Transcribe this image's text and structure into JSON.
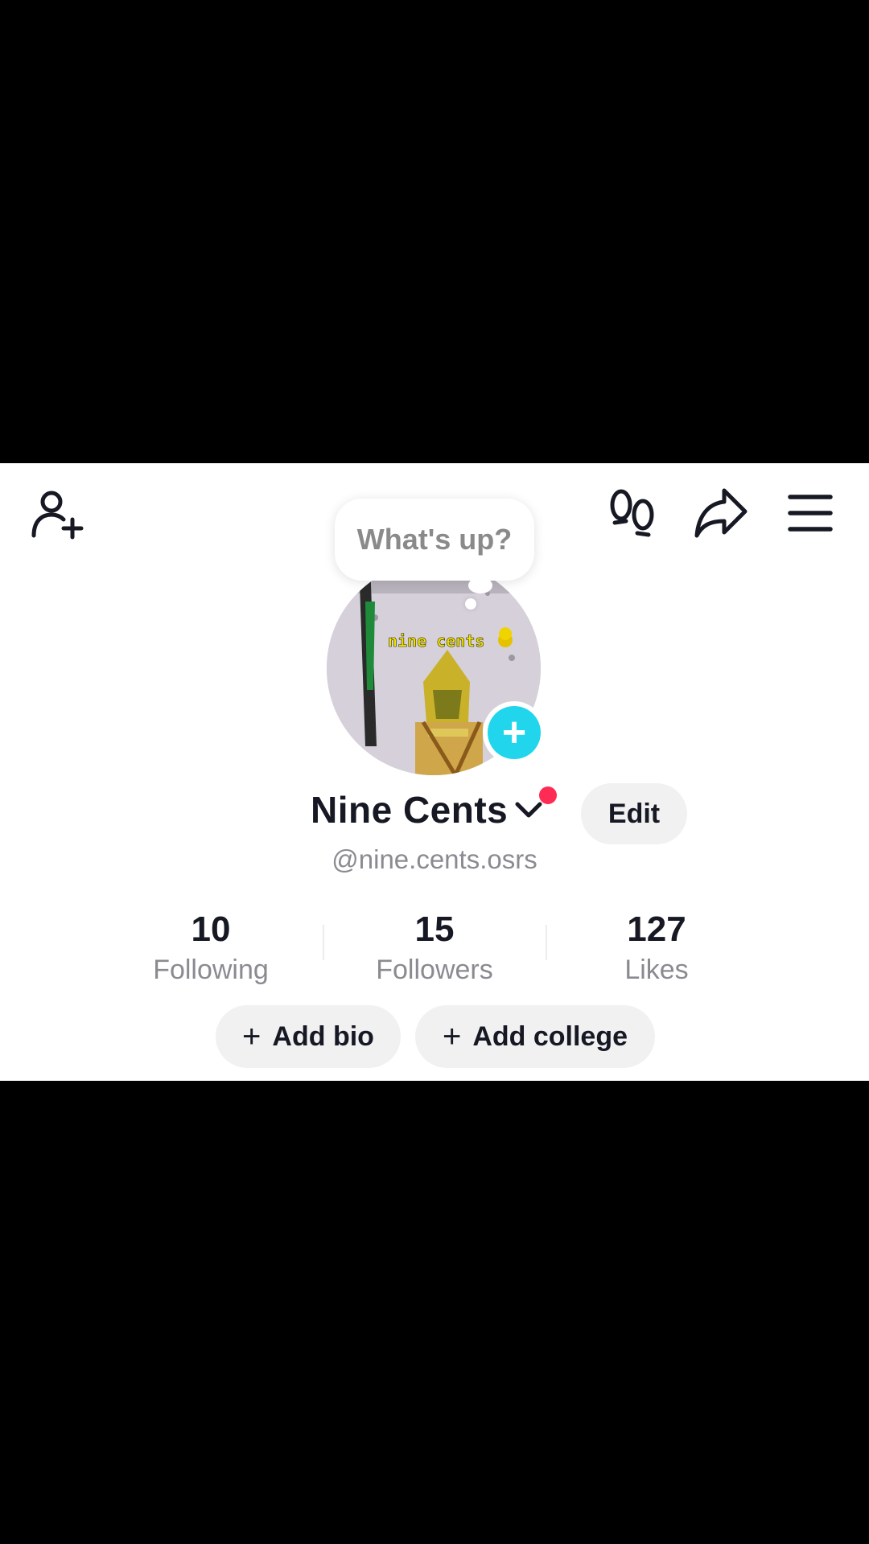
{
  "bubble": {
    "text": "What's up?"
  },
  "avatar": {
    "overlay_text": "nine cents"
  },
  "profile": {
    "name": "Nine Cents",
    "edit_label": "Edit",
    "handle": "@nine.cents.osrs"
  },
  "stats": [
    {
      "value": "10",
      "label": "Following"
    },
    {
      "value": "15",
      "label": "Followers"
    },
    {
      "value": "127",
      "label": "Likes"
    }
  ],
  "actions": {
    "add_bio": "Add bio",
    "add_college": "Add college",
    "plus": "+"
  },
  "icons": {
    "add_friend": "add-friend-icon",
    "footprints": "footprints-icon",
    "share": "share-icon",
    "menu": "menu-icon"
  },
  "colors": {
    "accent_cyan": "#20d5ec",
    "notification_red": "#fe2c55",
    "text_primary": "#161823",
    "text_secondary": "#8a8b91",
    "pill_bg": "#f1f1f2"
  }
}
